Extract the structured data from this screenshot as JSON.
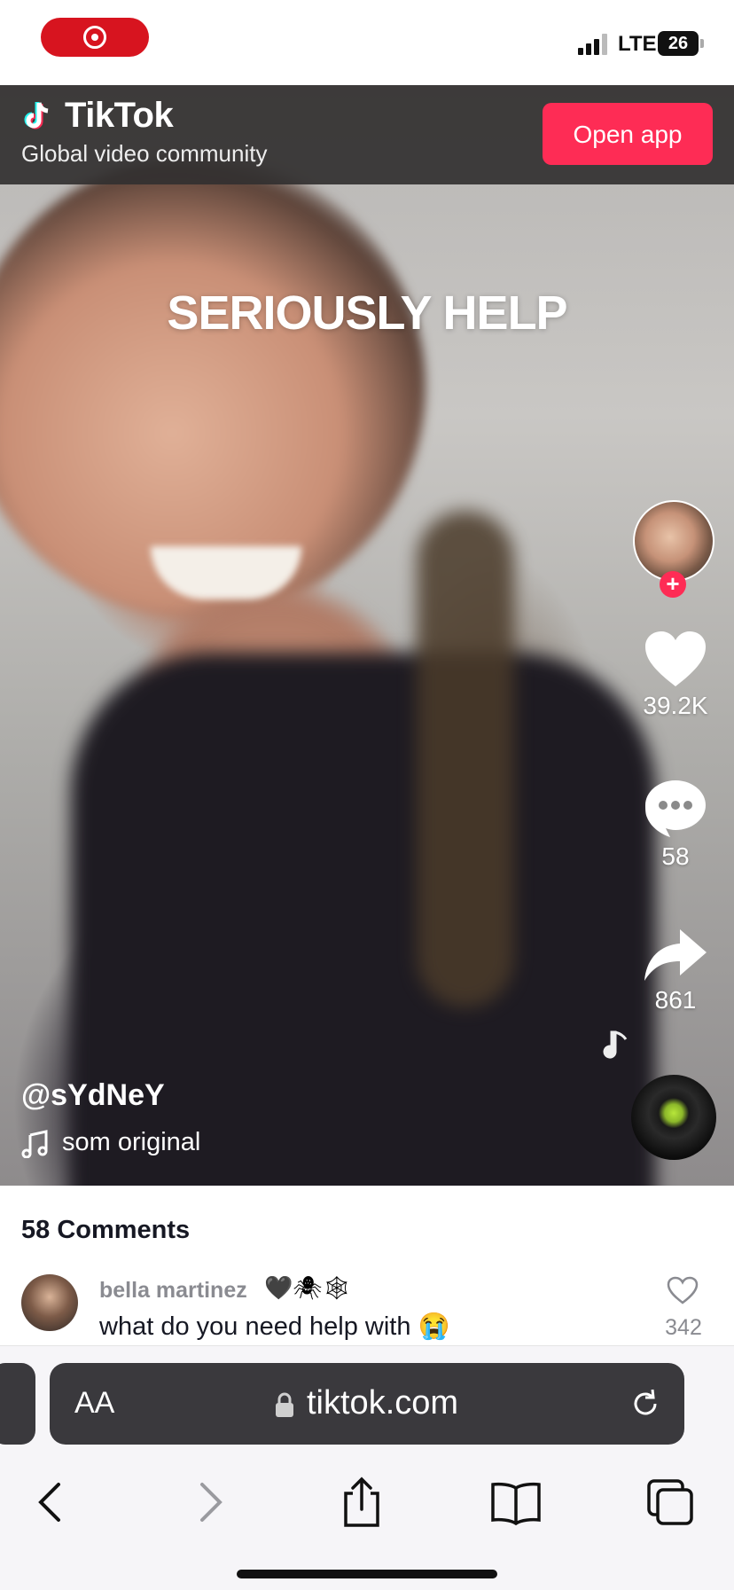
{
  "status_bar": {
    "network": "LTE",
    "battery": "26"
  },
  "banner": {
    "brand": "TikTok",
    "tagline": "Global video community",
    "open_app": "Open app"
  },
  "video": {
    "caption": "SERIOUSLY HELP",
    "username": "@sYdNeY",
    "sound": "som original",
    "likes": "39.2K",
    "comments": "58",
    "shares": "861"
  },
  "comments": {
    "title": "58 Comments",
    "items": [
      {
        "author": "bella martinez",
        "emojis": "🖤🕷🕸",
        "text": "what do you need help with 😭",
        "likes": "342"
      }
    ]
  },
  "browser": {
    "text_size_label": "AA",
    "url": "tiktok.com"
  },
  "colors": {
    "tiktok_red": "#fe2c55",
    "recording_red": "#d7141f",
    "address_bar": "#3a393d"
  }
}
